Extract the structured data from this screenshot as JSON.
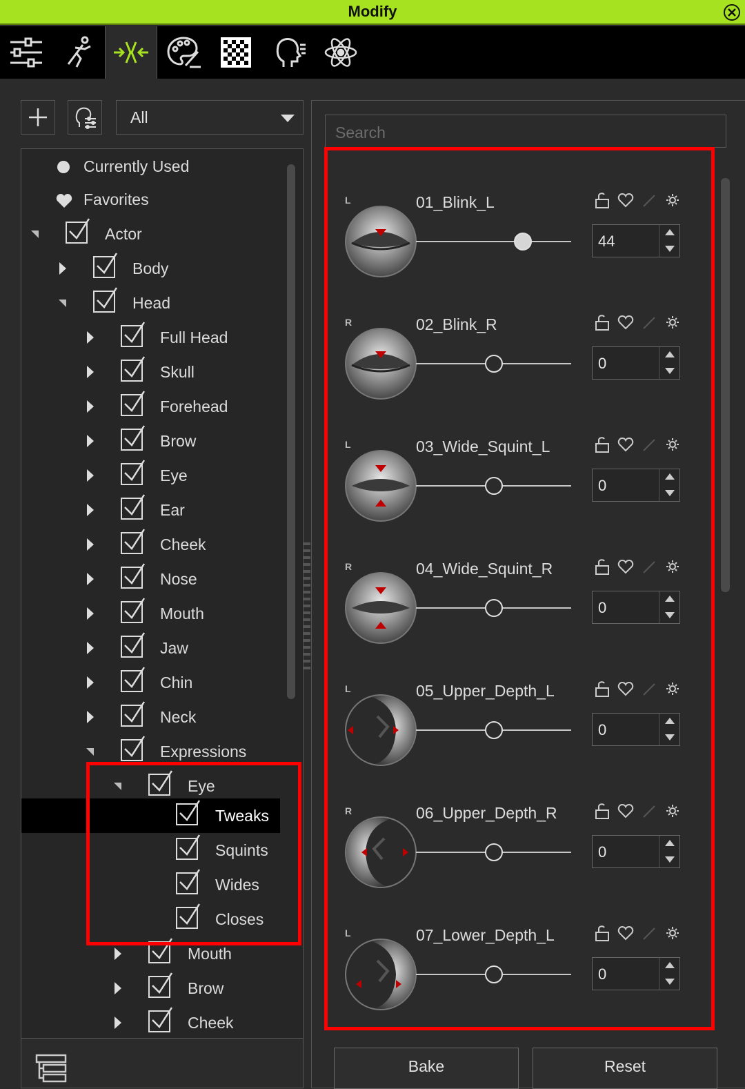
{
  "window": {
    "title": "Modify"
  },
  "toolbar": {
    "tabs": [
      {
        "icon": "sliders-icon"
      },
      {
        "icon": "motion-figure-icon"
      },
      {
        "icon": "morph-icon",
        "active": true
      },
      {
        "icon": "palette-icon"
      },
      {
        "icon": "checker-texture-icon"
      },
      {
        "icon": "head-profile-icon"
      },
      {
        "icon": "atom-icon"
      }
    ],
    "accent_color": "#a6e21f"
  },
  "filter": {
    "selected": "All"
  },
  "tree": {
    "currently_used": "Currently Used",
    "favorites": "Favorites",
    "actor": "Actor",
    "body": "Body",
    "head": "Head",
    "head_children": [
      "Full Head",
      "Skull",
      "Forehead",
      "Brow",
      "Eye",
      "Ear",
      "Cheek",
      "Nose",
      "Mouth",
      "Jaw",
      "Chin",
      "Neck"
    ],
    "expressions": "Expressions",
    "eye": "Eye",
    "eye_children": [
      "Tweaks",
      "Squints",
      "Wides",
      "Closes"
    ],
    "selected": "Tweaks",
    "expr_children": [
      "Mouth",
      "Brow",
      "Cheek"
    ]
  },
  "search": {
    "placeholder": "Search"
  },
  "morphs": [
    {
      "side": "L",
      "name": "01_Blink_L",
      "value": "44"
    },
    {
      "side": "R",
      "name": "02_Blink_R",
      "value": "0"
    },
    {
      "side": "L",
      "name": "03_Wide_Squint_L",
      "value": "0"
    },
    {
      "side": "R",
      "name": "04_Wide_Squint_R",
      "value": "0"
    },
    {
      "side": "L",
      "name": "05_Upper_Depth_L",
      "value": "0"
    },
    {
      "side": "R",
      "name": "06_Upper_Depth_R",
      "value": "0"
    },
    {
      "side": "L",
      "name": "07_Lower_Depth_L",
      "value": "0"
    }
  ],
  "buttons": {
    "bake": "Bake",
    "reset": "Reset"
  },
  "highlight_color": "#ff0000"
}
